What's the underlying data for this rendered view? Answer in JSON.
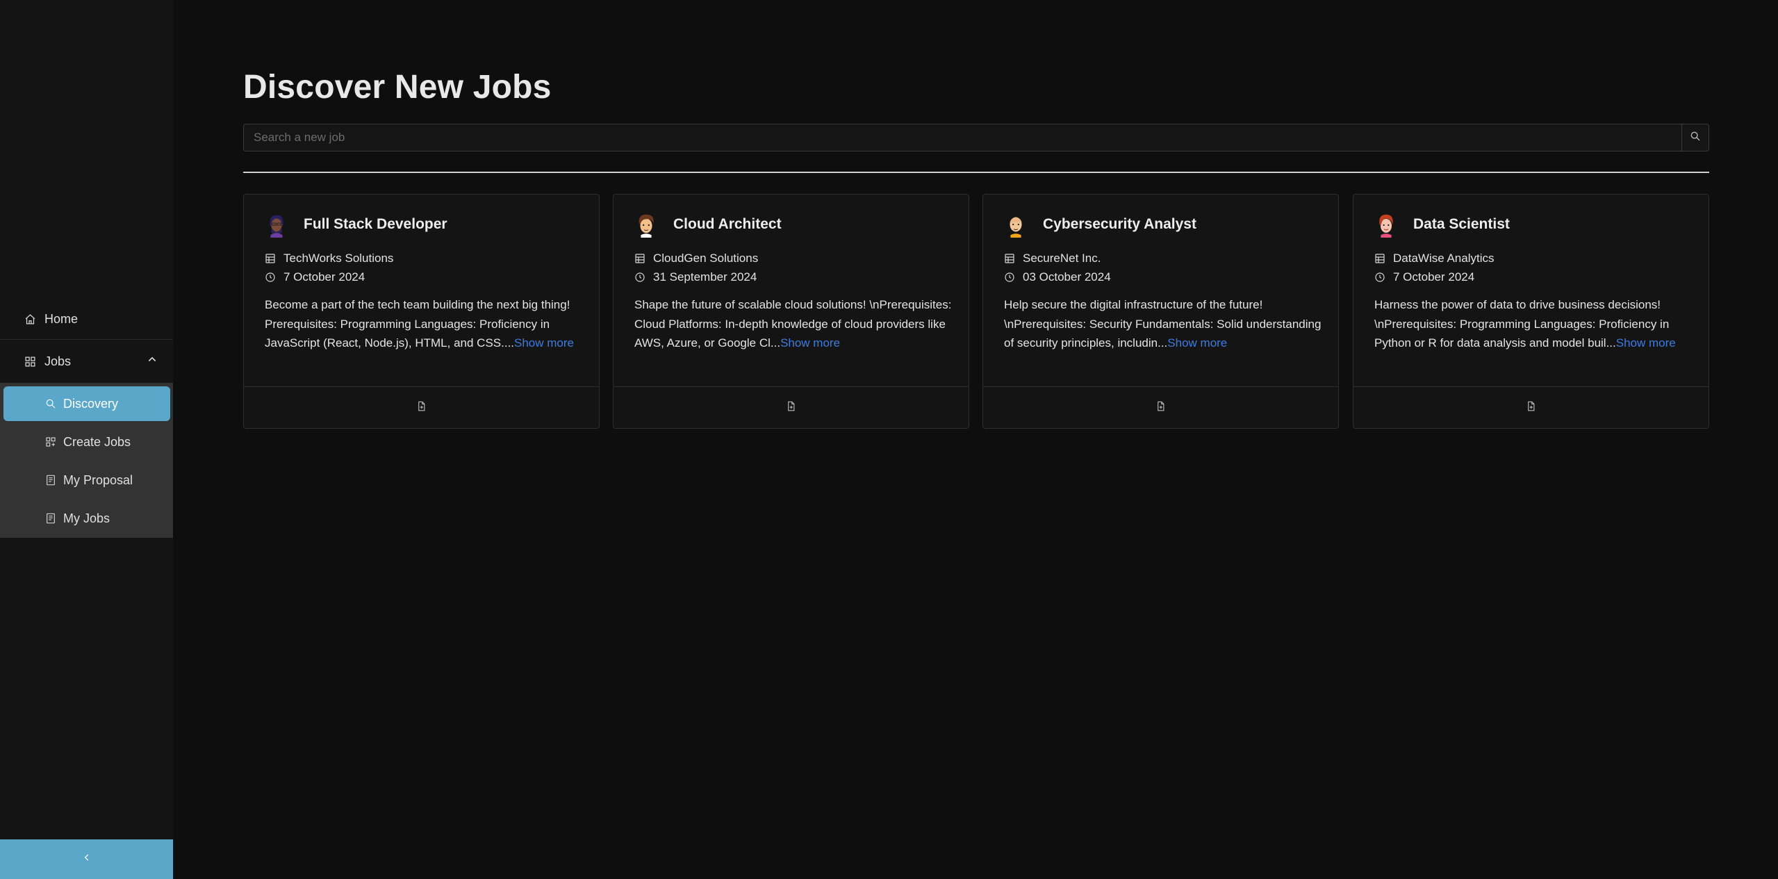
{
  "sidebar": {
    "home_label": "Home",
    "jobs_label": "Jobs",
    "sub_items": [
      {
        "label": "Discovery",
        "icon": "search-icon",
        "active": true
      },
      {
        "label": "Create Jobs",
        "icon": "grid-plus-icon",
        "active": false
      },
      {
        "label": "My Proposal",
        "icon": "document-icon",
        "active": false
      },
      {
        "label": "My Jobs",
        "icon": "document-icon",
        "active": false
      }
    ],
    "collapse_icon": "chevron-left-icon"
  },
  "page": {
    "title": "Discover New Jobs",
    "search_placeholder": "Search a new job",
    "search_value": ""
  },
  "jobs": [
    {
      "title": "Full Stack Developer",
      "company": "TechWorks Solutions",
      "date": "7 October 2024",
      "description": "Become a part of the tech team building the next big thing! Prerequisites: Programming Languages: Proficiency in JavaScript (React, Node.js), HTML, and CSS....",
      "show_more": "Show more",
      "avatar_icon": "avatar-purple-icon"
    },
    {
      "title": "Cloud Architect",
      "company": "CloudGen Solutions",
      "date": "31 September 2024",
      "description": "Shape the future of scalable cloud solutions! \\nPrerequisites: Cloud Platforms: In-depth knowledge of cloud providers like AWS, Azure, or Google Cl...",
      "show_more": "Show more",
      "avatar_icon": "avatar-brown-hair-icon"
    },
    {
      "title": "Cybersecurity Analyst",
      "company": "SecureNet Inc.",
      "date": "03 October 2024",
      "description": "Help secure the digital infrastructure of the future! \\nPrerequisites: Security Fundamentals: Solid understanding of security principles, includin...",
      "show_more": "Show more",
      "avatar_icon": "avatar-bald-icon"
    },
    {
      "title": "Data Scientist",
      "company": "DataWise Analytics",
      "date": "7 October 2024",
      "description": "Harness the power of data to drive business decisions! \\nPrerequisites: Programming Languages: Proficiency in Python or R for data analysis and model buil...",
      "show_more": "Show more",
      "avatar_icon": "avatar-red-hair-icon"
    }
  ],
  "colors": {
    "accent": "#5aa7c9",
    "background": "#0e0e0e",
    "link": "#3d7be0"
  }
}
